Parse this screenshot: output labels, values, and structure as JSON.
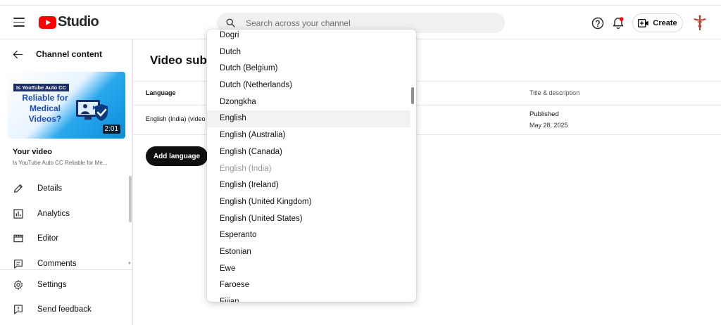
{
  "app": {
    "logo_text": "Studio"
  },
  "search": {
    "placeholder": "Search across your channel"
  },
  "header": {
    "create_label": "Create"
  },
  "sidebar": {
    "back_label": "Channel content",
    "thumbnail": {
      "line1": "Is YouTube Auto CC",
      "line2": "Reliable for Medical Videos?",
      "duration": "2:01"
    },
    "your_video_label": "Your video",
    "video_title": "Is YouTube Auto CC Reliable for Me...",
    "nav": [
      {
        "label": "Details",
        "icon": "pencil-icon"
      },
      {
        "label": "Analytics",
        "icon": "analytics-icon"
      },
      {
        "label": "Editor",
        "icon": "editor-icon"
      },
      {
        "label": "Comments",
        "icon": "comments-icon"
      }
    ],
    "settings_label": "Settings",
    "feedback_label": "Send feedback"
  },
  "main": {
    "page_title": "Video subt",
    "table": {
      "col_language": "Language",
      "col_title": "Title & description",
      "rows": [
        {
          "language": "English (India) (video",
          "status": "Published",
          "date": "May 28, 2025"
        }
      ]
    },
    "add_language_label": "Add language"
  },
  "dropdown": {
    "items": [
      {
        "label": "Dogri",
        "state": "normal"
      },
      {
        "label": "Dutch",
        "state": "normal"
      },
      {
        "label": "Dutch (Belgium)",
        "state": "normal"
      },
      {
        "label": "Dutch (Netherlands)",
        "state": "normal"
      },
      {
        "label": "Dzongkha",
        "state": "normal"
      },
      {
        "label": "English",
        "state": "hover"
      },
      {
        "label": "English (Australia)",
        "state": "normal"
      },
      {
        "label": "English (Canada)",
        "state": "normal"
      },
      {
        "label": "English (India)",
        "state": "disabled"
      },
      {
        "label": "English (Ireland)",
        "state": "normal"
      },
      {
        "label": "English (United Kingdom)",
        "state": "normal"
      },
      {
        "label": "English (United States)",
        "state": "normal"
      },
      {
        "label": "Esperanto",
        "state": "normal"
      },
      {
        "label": "Estonian",
        "state": "normal"
      },
      {
        "label": "Ewe",
        "state": "normal"
      },
      {
        "label": "Faroese",
        "state": "normal"
      },
      {
        "label": "Fijian",
        "state": "normal"
      }
    ]
  },
  "colors": {
    "brand_red": "#ff0000",
    "accent_dark": "#0f0f0f",
    "notification_dot": "#ff0000"
  }
}
